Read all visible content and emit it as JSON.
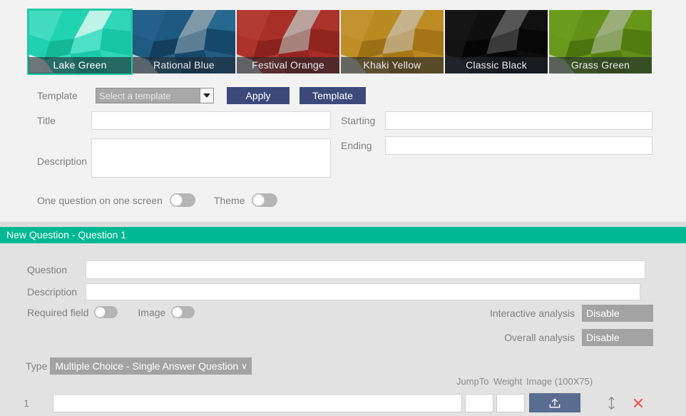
{
  "themes": {
    "cards": [
      {
        "name": "Lake Green",
        "selected": true,
        "base": "#1bcfae",
        "mid": "#43dcc0",
        "light": "#bff3e7",
        "pale": "#e9faf5",
        "dark": "#14b897"
      },
      {
        "name": "Rational Blue",
        "selected": false,
        "base": "#1b5378",
        "mid": "#23618a",
        "light": "#8099a6",
        "pale": "#b9c4c9",
        "dark": "#123f5e"
      },
      {
        "name": "Festival Orange",
        "selected": false,
        "base": "#a32b25",
        "mid": "#b23b33",
        "light": "#b9a39f",
        "pale": "#cfc2bf",
        "dark": "#8c221d"
      },
      {
        "name": "Khaki Yellow",
        "selected": false,
        "base": "#b5851d",
        "mid": "#c49331",
        "light": "#c5b38c",
        "pale": "#d9cdb2",
        "dark": "#9c7015"
      },
      {
        "name": "Classic Black",
        "selected": false,
        "base": "#0c0c0c",
        "mid": "#1a1a1a",
        "light": "#565656",
        "pale": "#7d7d7d",
        "dark": "#050505"
      },
      {
        "name": "Grass Green",
        "selected": false,
        "base": "#5d8b16",
        "mid": "#6b9c1e",
        "light": "#9aad7b",
        "pale": "#b6c39c",
        "dark": "#4c7410"
      }
    ]
  },
  "meta": {
    "template_label": "Template",
    "template_select_value": "Select a template",
    "apply_label": "Apply",
    "template_button_label": "Template",
    "title_label": "Title",
    "title_value": "",
    "title_placeholder": "",
    "description_label": "Description",
    "description_value": "",
    "description_placeholder": "",
    "starting_label": "Starting",
    "starting_value": "",
    "starting_placeholder": "",
    "ending_label": "Ending",
    "ending_value": "",
    "ending_placeholder": "",
    "one_question_label": "One question on one screen",
    "one_question_state": "off",
    "theme_label": "Theme",
    "theme_state": "off"
  },
  "question": {
    "banner": "New Question - Question 1",
    "question_label": "Question",
    "question_value": "",
    "question_placeholder": "",
    "description_label": "Description",
    "description_value": "",
    "description_placeholder": "",
    "required_label": "Required field",
    "required_state": "off",
    "image_label": "Image",
    "image_state": "off",
    "interactive_label": "Interactive analysis",
    "interactive_value": "Disable",
    "overall_label": "Overall analysis",
    "overall_value": "Disable",
    "type_label": "Type",
    "type_value": "Multiple Choice - Single Answer Question",
    "chevron": "∨"
  },
  "options": {
    "headers": {
      "jump_to": "JumpTo",
      "weight": "Weight",
      "image": "Image (100X75)"
    },
    "rows": [
      {
        "number": "1",
        "text": "",
        "text_placeholder": "",
        "jump_to": "",
        "weight": "",
        "upload_icon": "upload-icon",
        "move_icon": "move-updown-icon",
        "delete_icon": "delete-x-icon"
      }
    ]
  },
  "colors": {
    "accent_teal": "#00b894",
    "navy_button": "#3b4a7a",
    "upload_button": "#5b6c91",
    "grey_select": "#a3a3a3",
    "delete_red": "#e8564f",
    "panel_bg": "#e2e2e2",
    "page_bg": "#f2f2f2"
  }
}
